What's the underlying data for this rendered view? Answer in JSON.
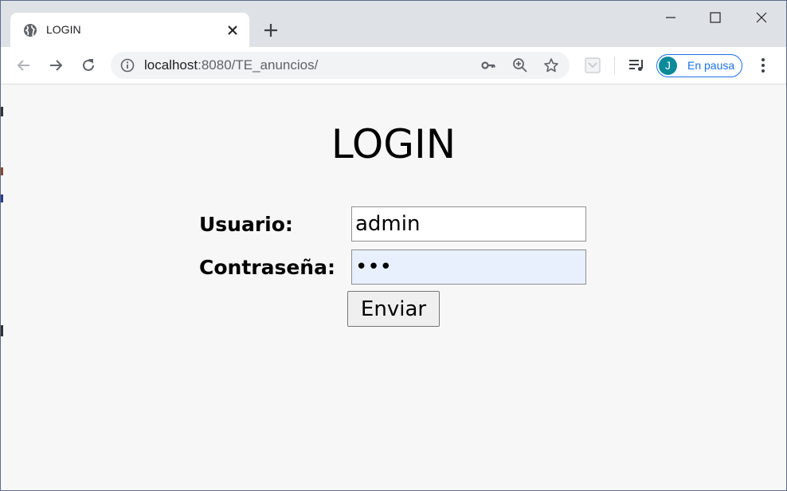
{
  "browser": {
    "tab": {
      "title": "LOGIN",
      "favicon": "globe-icon",
      "close_icon": "close-icon"
    },
    "new_tab_icon": "plus-icon",
    "window_controls": [
      "minimize-icon",
      "maximize-icon",
      "close-icon"
    ],
    "toolbar": {
      "back_icon": "arrow-left-icon",
      "forward_icon": "arrow-right-icon",
      "reload_icon": "reload-icon",
      "address": {
        "host": "localhost",
        "path": ":8080/TE_anuncios/",
        "info_icon": "info-icon",
        "key_icon": "key-icon",
        "zoom_icon": "zoom-in-icon",
        "bookmark_icon": "star-icon"
      },
      "extension_icon": "pocket-icon",
      "media_icon": "media-queue-icon",
      "profile": {
        "initial": "J",
        "label": "En pausa",
        "avatar_color": "#0b8a9a",
        "accent_color": "#1a73e8"
      },
      "menu_icon": "kebab-menu-icon"
    }
  },
  "page": {
    "title": "LOGIN",
    "form": {
      "username_label": "Usuario:",
      "username_value": "admin",
      "password_label": "Contraseña:",
      "password_value": "•••",
      "submit_label": "Enviar"
    },
    "background_color": "#f7f7f7",
    "autofill_color": "#e8f0fe"
  }
}
